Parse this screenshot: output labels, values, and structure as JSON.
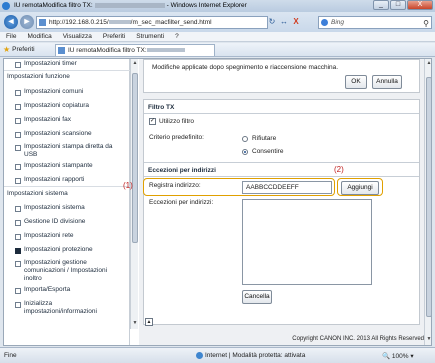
{
  "window": {
    "title_prefix": "IU remotaModifica filtro TX:",
    "title_suffix": "- Windows Internet Explorer",
    "minimize": "_",
    "maximize": "□",
    "close": "X"
  },
  "address": {
    "url_prefix": "http://192.168.0.215/",
    "url_suffix": "/m_sec_macfilter_send.html",
    "search_placeholder": "Bing",
    "back": "◄",
    "forward": "►",
    "refresh": "↻",
    "stop": "X",
    "search_icon": "⚲"
  },
  "menu": [
    "File",
    "Modifica",
    "Visualizza",
    "Preferiti",
    "Strumenti",
    "?"
  ],
  "favorites": {
    "label": "Preferiti",
    "tab_title": "IU remotaModifica filtro TX:"
  },
  "leftnav": {
    "items": [
      {
        "label": "Impostazioni timer",
        "type": "sub"
      },
      {
        "label": "Impostazioni funzione",
        "type": "head"
      },
      {
        "label": "Impostazioni comuni",
        "type": "sub"
      },
      {
        "label": "Impostazioni copiatura",
        "type": "sub"
      },
      {
        "label": "Impostazioni fax",
        "type": "sub"
      },
      {
        "label": "Impostazioni scansione",
        "type": "sub"
      },
      {
        "label": "Impostazioni stampa diretta da",
        "label2": "USB",
        "type": "sub"
      },
      {
        "label": "Impostazioni stampante",
        "type": "sub"
      },
      {
        "label": "Impostazioni rapporti",
        "type": "sub"
      },
      {
        "label": "Impostazioni sistema",
        "type": "head"
      },
      {
        "label": "Impostazioni sistema",
        "type": "sub"
      },
      {
        "label": "Gestione ID divisione",
        "type": "sub"
      },
      {
        "label": "Impostazioni rete",
        "type": "sub"
      },
      {
        "label": "Impostazioni protezione",
        "type": "sub",
        "active": true
      },
      {
        "label": "Impostazioni gestione",
        "label2": "comunicazioni / Impostazioni",
        "label3": "inoltro",
        "type": "sub"
      },
      {
        "label": "Importa/Esporta",
        "type": "sub"
      },
      {
        "label": "Inizializza",
        "label2": "impostazioni/informazioni",
        "type": "sub"
      }
    ]
  },
  "main": {
    "notice": "Modifiche applicate dopo spegnimento e riaccensione macchina.",
    "ok_label": "OK",
    "cancel_label": "Annulla",
    "filter_section": "Filtro TX",
    "use_filter_label": "Utilizzo filtro",
    "use_filter_checked": true,
    "default_policy_label": "Criterio predefinito:",
    "reject_label": "Rifiutare",
    "allow_label": "Consentire",
    "default_policy_value": "Consentire",
    "exceptions_section": "Eccezioni per indirizzi",
    "register_label": "Registra indirizzo:",
    "register_value": "AABBCCDDEEFF",
    "add_label": "Aggiungi",
    "exceptions_list_label": "Eccezioni per indirizzi:",
    "exceptions_list": [],
    "delete_label": "Cancella",
    "callout1": "(1)",
    "callout2": "(2)",
    "to_top_icon": "▲",
    "copyright": "Copyright CANON INC. 2013 All Rights Reserved"
  },
  "status": {
    "left": "Fine",
    "zone": "Internet | Modalità protetta: attivata",
    "zoom": "100%"
  }
}
